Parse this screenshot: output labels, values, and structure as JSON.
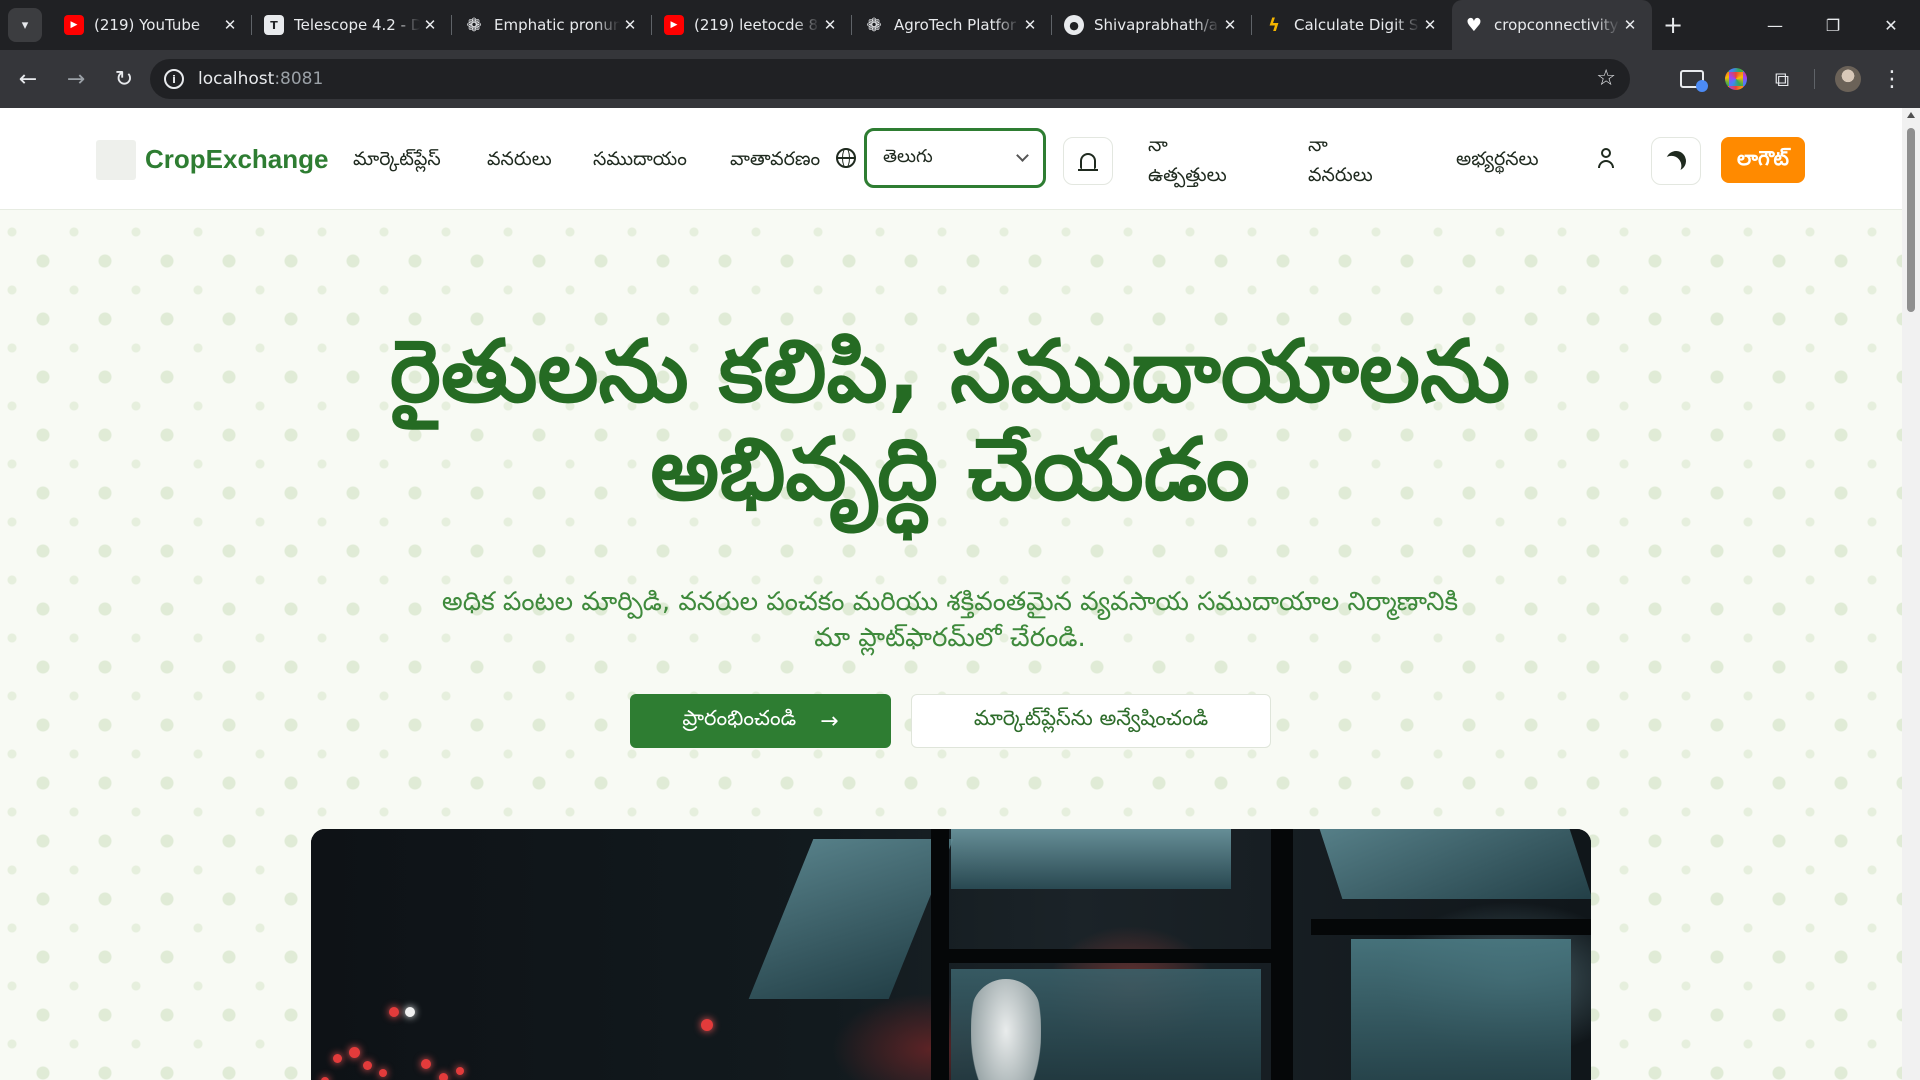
{
  "browser": {
    "tabs": [
      {
        "title": "(219) YouTube",
        "favicon": "youtube-icon",
        "active": false
      },
      {
        "title": "Telescope 4.2 - D",
        "favicon": "telescope-icon",
        "active": false
      },
      {
        "title": "Emphatic pronun",
        "favicon": "chatgpt-icon",
        "active": false
      },
      {
        "title": "(219) leetocde 8(",
        "favicon": "youtube-icon",
        "active": false
      },
      {
        "title": "AgroTech Platfor",
        "favicon": "chatgpt-icon",
        "active": false
      },
      {
        "title": "Shivaprabhath/a",
        "favicon": "github-icon",
        "active": false
      },
      {
        "title": "Calculate Digit S",
        "favicon": "calculator-icon",
        "active": false
      },
      {
        "title": "cropconnectivity",
        "favicon": "heart-icon",
        "active": true
      }
    ],
    "address": {
      "host": "localhost",
      "port": ":8081"
    }
  },
  "site": {
    "brand": "CropExchange",
    "nav": {
      "marketplace": "మార్కెట్‌ప్లేస్",
      "resources": "వనరులు",
      "community": "సముదాయం",
      "weather": "వాతావరణం",
      "language_selected": "తెలుగు",
      "my_products_line1": "నా",
      "my_products_line2": "ఉత్పత్తులు",
      "my_resources_line1": "నా",
      "my_resources_line2": "వనరులు",
      "requests": "అభ్యర్థనలు",
      "logout": "లాగౌట్"
    },
    "hero": {
      "title": "రైతులను కలిపి, సముదాయాలను అభివృద్ధి చేయడం",
      "subtitle": "అధిక పంటల మార్పిడి, వనరుల పంచకం మరియు శక్తివంతమైన వ్యవసాయ సముదాయాల నిర్మాణానికి మా ప్లాట్‌ఫారమ్‌లో చేరండి.",
      "primary_button": "ప్రారంభించండి",
      "secondary_button": "మార్కెట్‌ప్లేస్‌ను అన్వేషించండి"
    },
    "colors": {
      "brand_green": "#2e7d32",
      "logout_orange": "#ff8a00",
      "hero_text": "#256b23"
    }
  }
}
